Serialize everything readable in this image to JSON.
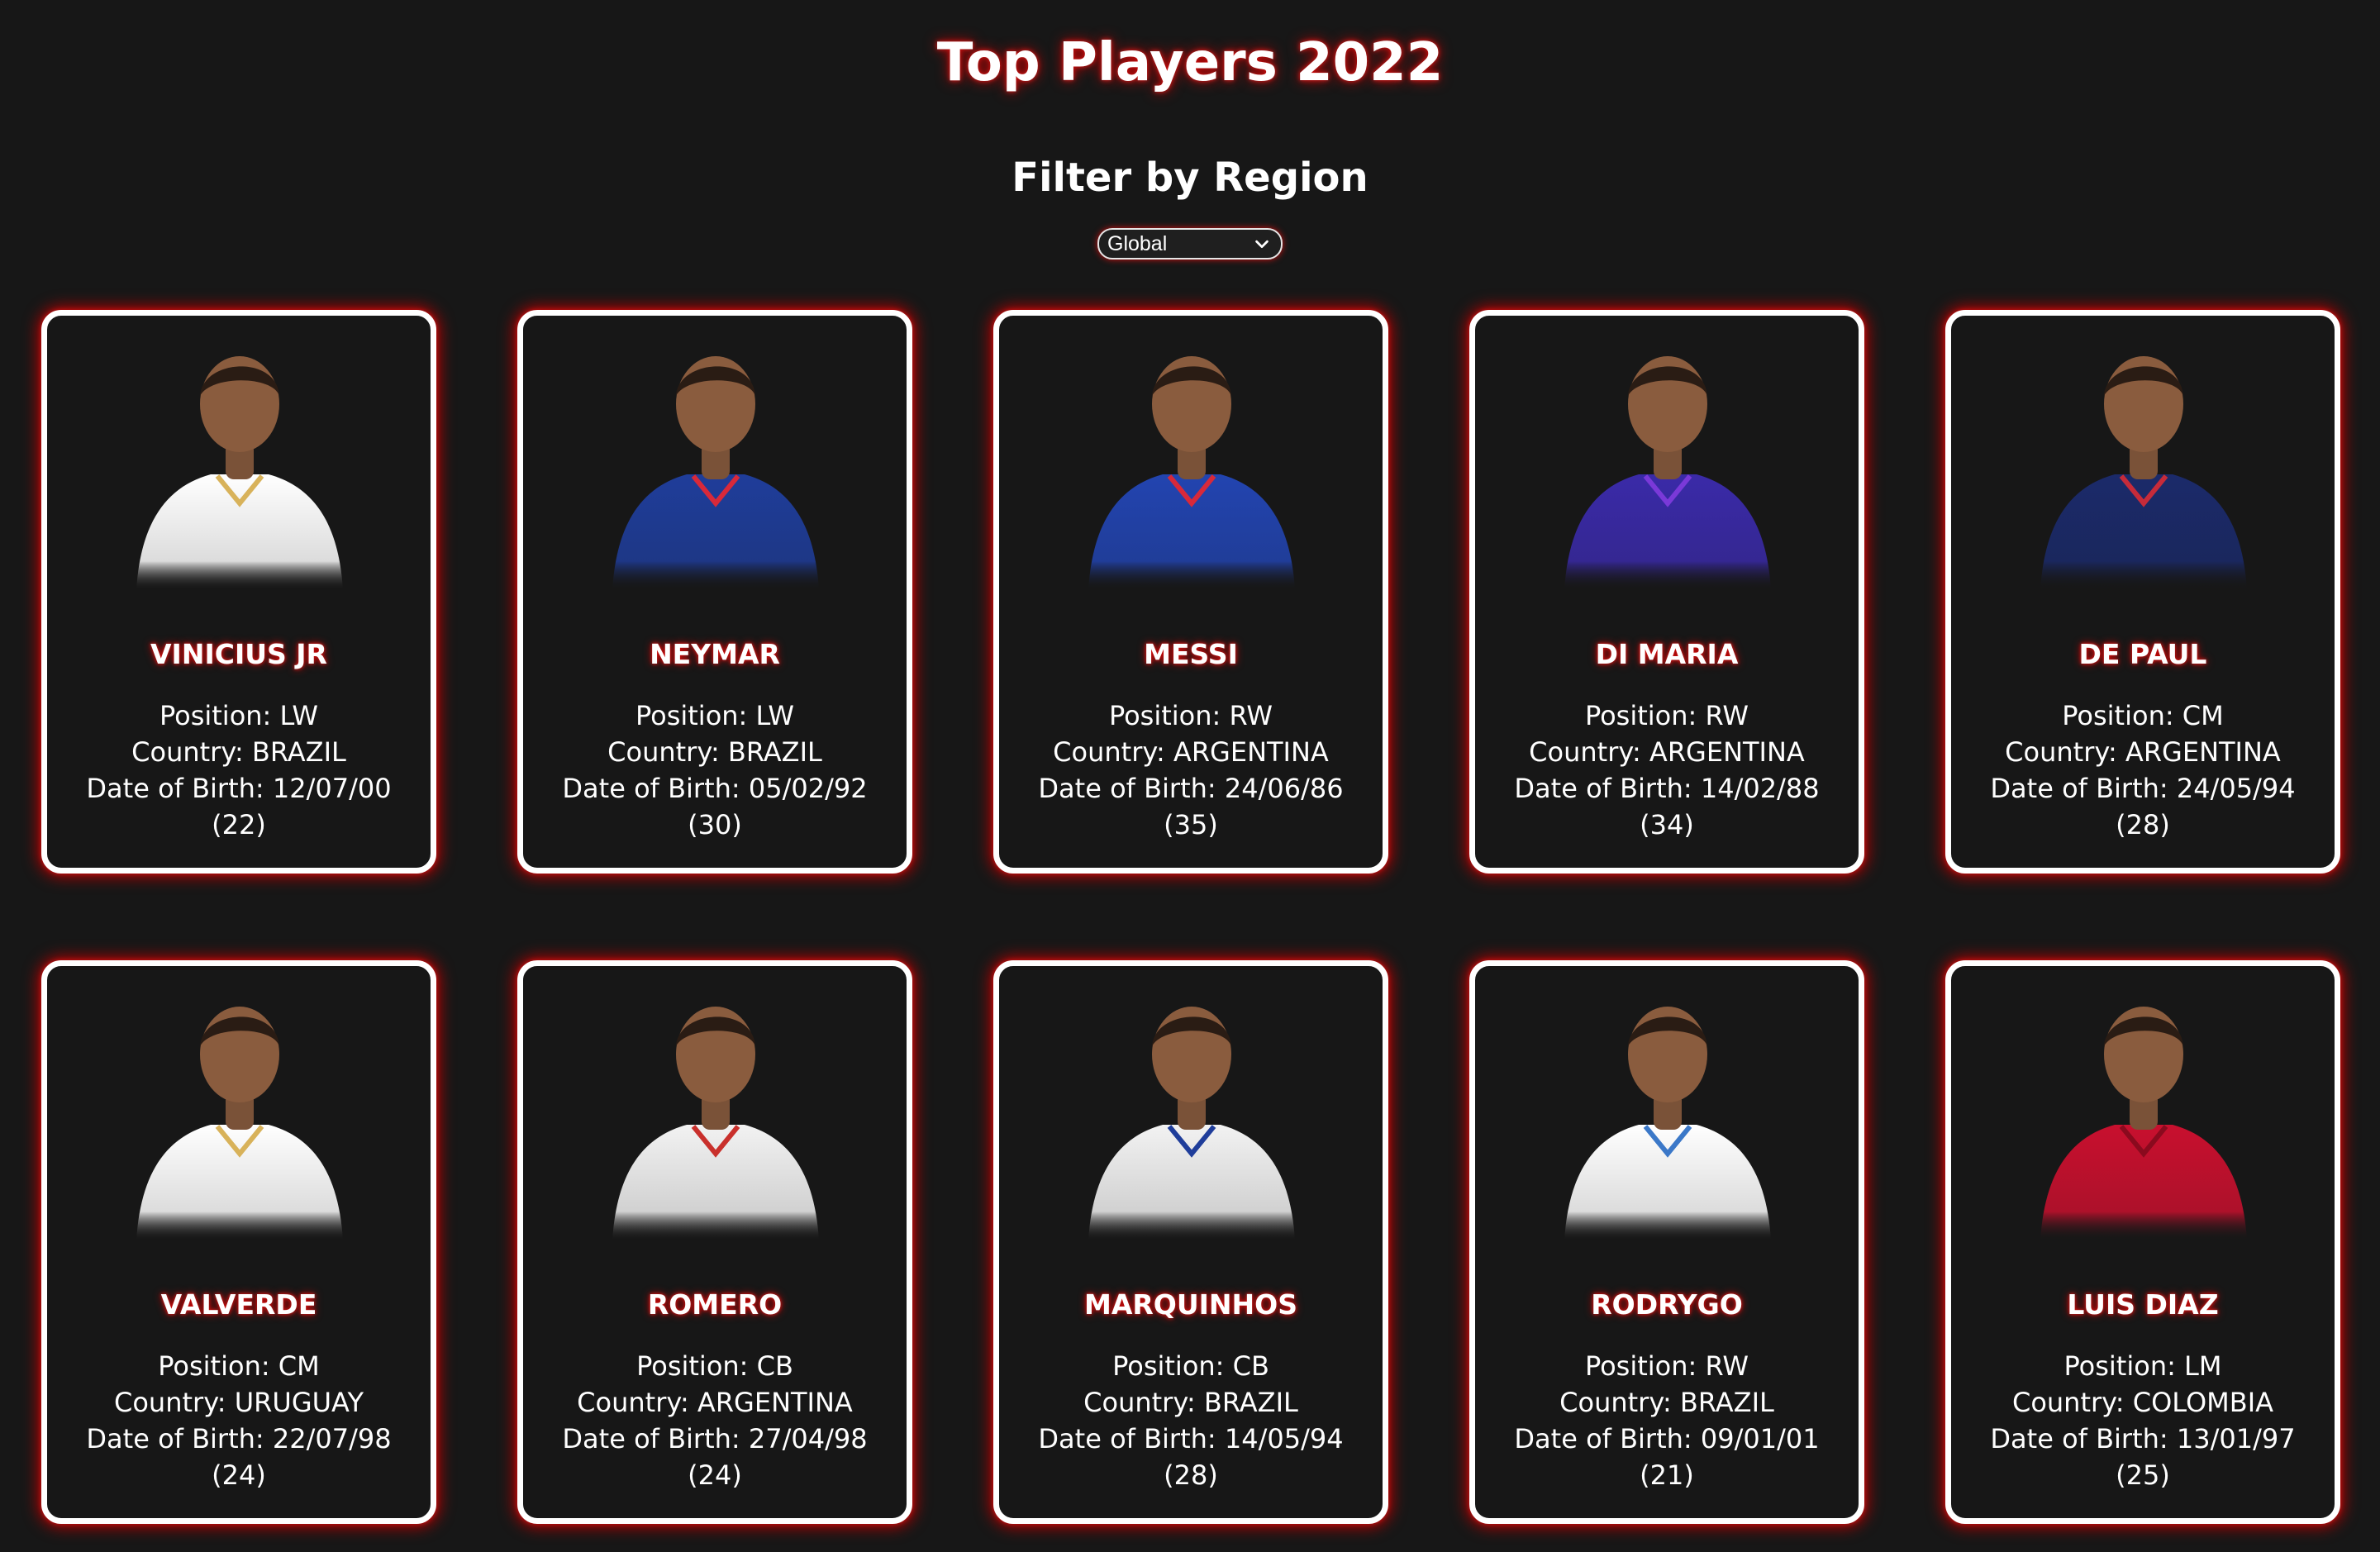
{
  "page": {
    "title": "Top Players 2022",
    "filter_heading": "Filter by Region",
    "region_select": {
      "selected": "Global"
    }
  },
  "labels": {
    "position": "Position: ",
    "country": "Country: ",
    "dob": "Date of Birth: "
  },
  "players": [
    {
      "name": "VINICIUS JR",
      "position": "LW",
      "country": "BRAZIL",
      "dob": "12/07/00",
      "age": "(22)",
      "shirt": "#ffffff",
      "accent": "#d8b25a"
    },
    {
      "name": "NEYMAR",
      "position": "LW",
      "country": "BRAZIL",
      "dob": "05/02/92",
      "age": "(30)",
      "shirt": "#1f3d9a",
      "accent": "#d8293a"
    },
    {
      "name": "MESSI",
      "position": "RW",
      "country": "ARGENTINA",
      "dob": "24/06/86",
      "age": "(35)",
      "shirt": "#2244b0",
      "accent": "#d8293a"
    },
    {
      "name": "DI MARIA",
      "position": "RW",
      "country": "ARGENTINA",
      "dob": "14/02/88",
      "age": "(34)",
      "shirt": "#3a2aa8",
      "accent": "#7a39d8"
    },
    {
      "name": "DE PAUL",
      "position": "CM",
      "country": "ARGENTINA",
      "dob": "24/05/94",
      "age": "(28)",
      "shirt": "#1b2a6a",
      "accent": "#c62b3a"
    },
    {
      "name": "VALVERDE",
      "position": "CM",
      "country": "URUGUAY",
      "dob": "22/07/98",
      "age": "(24)",
      "shirt": "#ffffff",
      "accent": "#d8b25a"
    },
    {
      "name": "ROMERO",
      "position": "CB",
      "country": "ARGENTINA",
      "dob": "27/04/98",
      "age": "(24)",
      "shirt": "#f2f2f2",
      "accent": "#c9302c"
    },
    {
      "name": "MARQUINHOS",
      "position": "CB",
      "country": "BRAZIL",
      "dob": "14/05/94",
      "age": "(28)",
      "shirt": "#f2f2f2",
      "accent": "#1f3d9a"
    },
    {
      "name": "RODRYGO",
      "position": "RW",
      "country": "BRAZIL",
      "dob": "09/01/01",
      "age": "(21)",
      "shirt": "#ffffff",
      "accent": "#3b78c8"
    },
    {
      "name": "LUIS DIAZ",
      "position": "LM",
      "country": "COLOMBIA",
      "dob": "13/01/97",
      "age": "(25)",
      "shirt": "#c8102e",
      "accent": "#8a0a1e"
    }
  ]
}
